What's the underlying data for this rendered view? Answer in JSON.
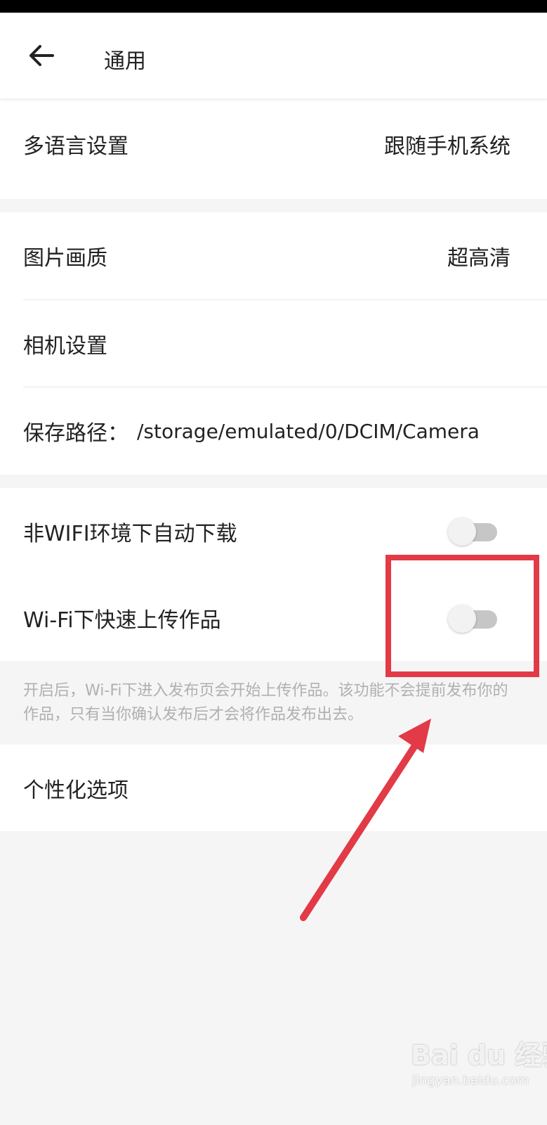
{
  "header": {
    "title": "通用"
  },
  "language": {
    "label": "多语言设置",
    "value": "跟随手机系统"
  },
  "media": {
    "image_quality_label": "图片画质",
    "image_quality_value": "超高清",
    "camera_label": "相机设置",
    "save_path_label": "保存路径：",
    "save_path_value": "/storage/emulated/0/DCIM/Camera"
  },
  "network": {
    "auto_download_label": "非WIFI环境下自动下载",
    "auto_download_on": false,
    "fast_upload_label": "Wi-Fi下快速上传作品",
    "fast_upload_on": false,
    "hint": "开启后，Wi-Fi下进入发布页会开始上传作品。该功能不会提前发布你的作品，只有当你确认发布后才会将作品发布出去。"
  },
  "personalization": {
    "label": "个性化选项"
  },
  "watermark": {
    "logo": "Bai du 经验",
    "url": "jingyan.baidu.com"
  },
  "colors": {
    "annotation": "#e23a46",
    "toggle_off_track": "#c6c6c6",
    "background": "#f5f5f5"
  }
}
